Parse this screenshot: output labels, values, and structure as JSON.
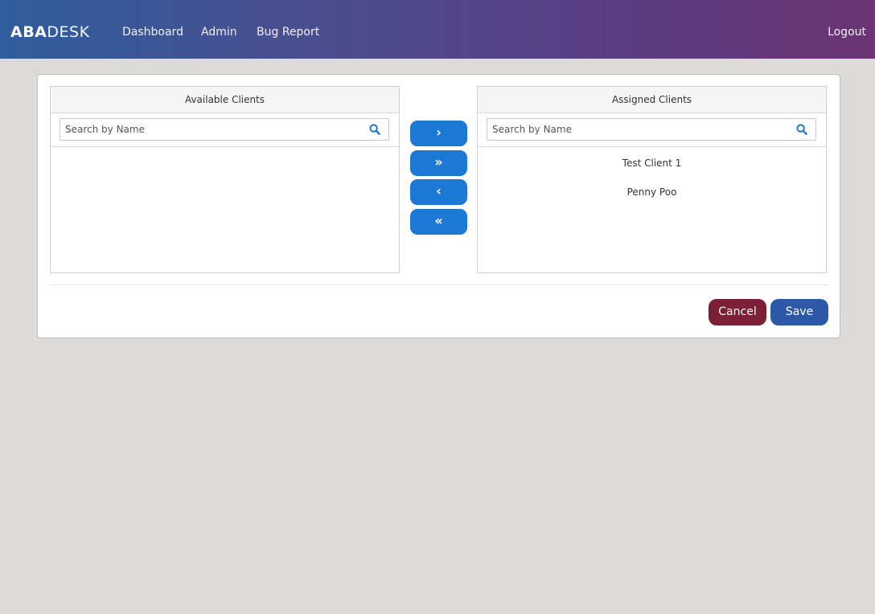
{
  "brand": {
    "bold": "ABA",
    "thin": "DESK"
  },
  "nav": {
    "dashboard": "Dashboard",
    "admin": "Admin",
    "bug_report": "Bug Report",
    "logout": "Logout"
  },
  "available": {
    "title": "Available Clients",
    "search_placeholder": "Search by Name",
    "items": []
  },
  "assigned": {
    "title": "Assigned Clients",
    "search_placeholder": "Search by Name",
    "items": [
      "Test Client 1",
      "Penny Poo"
    ]
  },
  "transfer": {
    "move_right": "›",
    "move_all_right": "»",
    "move_left": "‹",
    "move_all_left": "«"
  },
  "actions": {
    "cancel": "Cancel",
    "save": "Save"
  },
  "colors": {
    "transfer_button": "#1b78d4",
    "cancel_button": "#7a1f35",
    "save_button": "#2e59a8"
  }
}
